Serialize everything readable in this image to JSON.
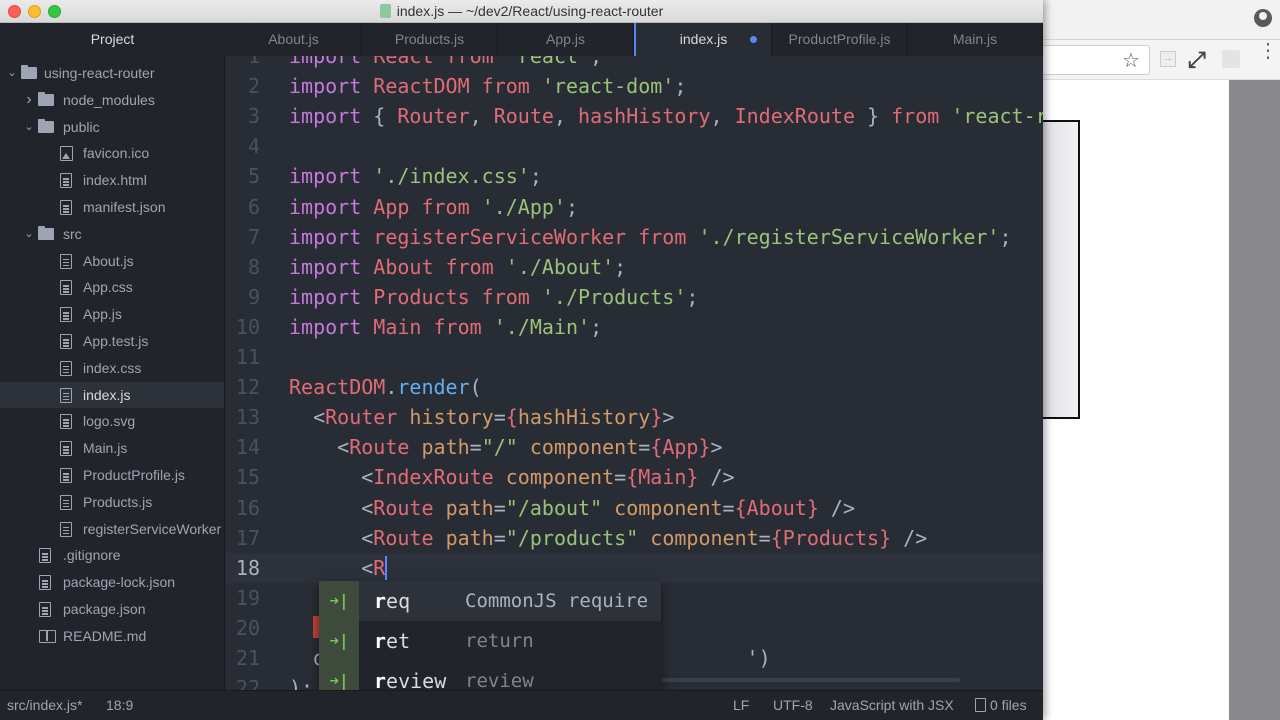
{
  "window": {
    "title": "index.js — ~/dev2/React/using-react-router"
  },
  "tabs": {
    "project_label": "Project",
    "items": [
      {
        "label": "About.js",
        "active": false
      },
      {
        "label": "Products.js",
        "active": false
      },
      {
        "label": "App.js",
        "active": false
      },
      {
        "label": "index.js",
        "active": true,
        "modified": true
      },
      {
        "label": "ProductProfile.js",
        "active": false
      },
      {
        "label": "Main.js",
        "active": false
      }
    ]
  },
  "tree": {
    "items": [
      {
        "label": "using-react-router",
        "type": "folder",
        "expanded": true,
        "depth": 0
      },
      {
        "label": "node_modules",
        "type": "folder",
        "expanded": false,
        "depth": 1
      },
      {
        "label": "public",
        "type": "folder",
        "expanded": true,
        "depth": 1
      },
      {
        "label": "favicon.ico",
        "type": "image",
        "depth": 2
      },
      {
        "label": "index.html",
        "type": "file",
        "depth": 2
      },
      {
        "label": "manifest.json",
        "type": "file",
        "depth": 2
      },
      {
        "label": "src",
        "type": "folder",
        "expanded": true,
        "depth": 1
      },
      {
        "label": "About.js",
        "type": "file",
        "depth": 2
      },
      {
        "label": "App.css",
        "type": "file",
        "depth": 2
      },
      {
        "label": "App.js",
        "type": "file",
        "depth": 2
      },
      {
        "label": "App.test.js",
        "type": "file",
        "depth": 2
      },
      {
        "label": "index.css",
        "type": "file",
        "depth": 2
      },
      {
        "label": "index.js",
        "type": "file",
        "depth": 2,
        "selected": true
      },
      {
        "label": "logo.svg",
        "type": "file",
        "depth": 2
      },
      {
        "label": "Main.js",
        "type": "file",
        "depth": 2
      },
      {
        "label": "ProductProfile.js",
        "type": "file",
        "depth": 2
      },
      {
        "label": "Products.js",
        "type": "file",
        "depth": 2
      },
      {
        "label": "registerServiceWorker",
        "type": "file",
        "depth": 2
      },
      {
        "label": ".gitignore",
        "type": "file",
        "depth": 1
      },
      {
        "label": "package-lock.json",
        "type": "file",
        "depth": 1
      },
      {
        "label": "package.json",
        "type": "file",
        "depth": 1
      },
      {
        "label": "README.md",
        "type": "book",
        "depth": 1
      }
    ]
  },
  "editor": {
    "lines": [
      {
        "n": "1",
        "tokens": [
          [
            "kw",
            "import"
          ],
          [
            "pun",
            " "
          ],
          [
            "id",
            "React"
          ],
          [
            "pun",
            " "
          ],
          [
            "id",
            "from"
          ],
          [
            "pun",
            " "
          ],
          [
            "str",
            "'react'"
          ],
          [
            "pun",
            ";"
          ]
        ]
      },
      {
        "n": "2",
        "tokens": [
          [
            "kw",
            "import"
          ],
          [
            "pun",
            " "
          ],
          [
            "id",
            "ReactDOM"
          ],
          [
            "pun",
            " "
          ],
          [
            "id",
            "from"
          ],
          [
            "pun",
            " "
          ],
          [
            "str",
            "'react-dom'"
          ],
          [
            "pun",
            ";"
          ]
        ]
      },
      {
        "n": "3",
        "tokens": [
          [
            "kw",
            "import"
          ],
          [
            "pun",
            " { "
          ],
          [
            "id",
            "Router"
          ],
          [
            "pun",
            ", "
          ],
          [
            "id",
            "Route"
          ],
          [
            "pun",
            ", "
          ],
          [
            "id",
            "hashHistory"
          ],
          [
            "pun",
            ", "
          ],
          [
            "id",
            "IndexRoute"
          ],
          [
            "pun",
            " } "
          ],
          [
            "id",
            "from"
          ],
          [
            "pun",
            " "
          ],
          [
            "str",
            "'react-router'"
          ],
          [
            "pun",
            ";"
          ]
        ]
      },
      {
        "n": "4",
        "tokens": []
      },
      {
        "n": "5",
        "tokens": [
          [
            "kw",
            "import"
          ],
          [
            "pun",
            " "
          ],
          [
            "str",
            "'./index.css'"
          ],
          [
            "pun",
            ";"
          ]
        ]
      },
      {
        "n": "6",
        "tokens": [
          [
            "kw",
            "import"
          ],
          [
            "pun",
            " "
          ],
          [
            "id",
            "App"
          ],
          [
            "pun",
            " "
          ],
          [
            "id",
            "from"
          ],
          [
            "pun",
            " "
          ],
          [
            "str",
            "'./App'"
          ],
          [
            "pun",
            ";"
          ]
        ]
      },
      {
        "n": "7",
        "tokens": [
          [
            "kw",
            "import"
          ],
          [
            "pun",
            " "
          ],
          [
            "id",
            "registerServiceWorker"
          ],
          [
            "pun",
            " "
          ],
          [
            "id",
            "from"
          ],
          [
            "pun",
            " "
          ],
          [
            "str",
            "'./registerServiceWorker'"
          ],
          [
            "pun",
            ";"
          ]
        ]
      },
      {
        "n": "8",
        "tokens": [
          [
            "kw",
            "import"
          ],
          [
            "pun",
            " "
          ],
          [
            "id",
            "About"
          ],
          [
            "pun",
            " "
          ],
          [
            "id",
            "from"
          ],
          [
            "pun",
            " "
          ],
          [
            "str",
            "'./About'"
          ],
          [
            "pun",
            ";"
          ]
        ]
      },
      {
        "n": "9",
        "tokens": [
          [
            "kw",
            "import"
          ],
          [
            "pun",
            " "
          ],
          [
            "id",
            "Products"
          ],
          [
            "pun",
            " "
          ],
          [
            "id",
            "from"
          ],
          [
            "pun",
            " "
          ],
          [
            "str",
            "'./Products'"
          ],
          [
            "pun",
            ";"
          ]
        ]
      },
      {
        "n": "10",
        "tokens": [
          [
            "kw",
            "import"
          ],
          [
            "pun",
            " "
          ],
          [
            "id",
            "Main"
          ],
          [
            "pun",
            " "
          ],
          [
            "id",
            "from"
          ],
          [
            "pun",
            " "
          ],
          [
            "str",
            "'./Main'"
          ],
          [
            "pun",
            ";"
          ]
        ]
      },
      {
        "n": "11",
        "tokens": []
      },
      {
        "n": "12",
        "tokens": [
          [
            "id",
            "ReactDOM"
          ],
          [
            "pun",
            "."
          ],
          [
            "fn",
            "render"
          ],
          [
            "pun",
            "("
          ]
        ]
      },
      {
        "n": "13",
        "tokens": [
          [
            "pun",
            "  <"
          ],
          [
            "id",
            "Router"
          ],
          [
            "pun",
            " "
          ],
          [
            "attr",
            "history"
          ],
          [
            "pun",
            "="
          ],
          [
            "id",
            "{"
          ],
          [
            "attr",
            "hashHistory"
          ],
          [
            "id",
            "}"
          ],
          [
            "pun",
            ">"
          ]
        ]
      },
      {
        "n": "14",
        "tokens": [
          [
            "pun",
            "    <"
          ],
          [
            "id",
            "Route"
          ],
          [
            "pun",
            " "
          ],
          [
            "attr",
            "path"
          ],
          [
            "pun",
            "="
          ],
          [
            "str",
            "\"/\""
          ],
          [
            "pun",
            " "
          ],
          [
            "attr",
            "component"
          ],
          [
            "pun",
            "="
          ],
          [
            "id",
            "{App}"
          ],
          [
            "pun",
            ">"
          ]
        ]
      },
      {
        "n": "15",
        "tokens": [
          [
            "pun",
            "      <"
          ],
          [
            "id",
            "IndexRoute"
          ],
          [
            "pun",
            " "
          ],
          [
            "attr",
            "component"
          ],
          [
            "pun",
            "="
          ],
          [
            "id",
            "{Main}"
          ],
          [
            "pun",
            " />"
          ]
        ]
      },
      {
        "n": "16",
        "tokens": [
          [
            "pun",
            "      <"
          ],
          [
            "id",
            "Route"
          ],
          [
            "pun",
            " "
          ],
          [
            "attr",
            "path"
          ],
          [
            "pun",
            "="
          ],
          [
            "str",
            "\"/about\""
          ],
          [
            "pun",
            " "
          ],
          [
            "attr",
            "component"
          ],
          [
            "pun",
            "="
          ],
          [
            "id",
            "{About}"
          ],
          [
            "pun",
            " />"
          ]
        ]
      },
      {
        "n": "17",
        "tokens": [
          [
            "pun",
            "      <"
          ],
          [
            "id",
            "Route"
          ],
          [
            "pun",
            " "
          ],
          [
            "attr",
            "path"
          ],
          [
            "pun",
            "="
          ],
          [
            "str",
            "\"/products\""
          ],
          [
            "pun",
            " "
          ],
          [
            "attr",
            "component"
          ],
          [
            "pun",
            "="
          ],
          [
            "id",
            "{Products}"
          ],
          [
            "pun",
            " />"
          ]
        ]
      },
      {
        "n": "18",
        "tokens": [
          [
            "pun",
            "      <"
          ],
          [
            "id",
            "R"
          ]
        ],
        "cursor": true
      },
      {
        "n": "19",
        "tokens": []
      },
      {
        "n": "20",
        "tokens": []
      },
      {
        "n": "21",
        "tokens": [
          [
            "pun",
            "  d                                   ')"
          ]
        ]
      },
      {
        "n": "22",
        "tokens": [
          [
            "pun",
            ");"
          ]
        ]
      }
    ]
  },
  "autocomplete": {
    "items": [
      {
        "prefix": "r",
        "rest": "eq",
        "desc": "CommonJS require",
        "selected": true
      },
      {
        "prefix": "r",
        "rest": "et",
        "desc": "return",
        "selected": false
      },
      {
        "prefix": "r",
        "rest": "eview",
        "desc": "review",
        "selected": false
      }
    ],
    "icon": "snippet-tab-icon"
  },
  "status": {
    "file_path": "src/index.js*",
    "cursor_pos": "18:9",
    "line_ending": "LF",
    "encoding": "UTF-8",
    "grammar": "JavaScript with JSX",
    "git_files": "0 files"
  },
  "browser": {
    "accent": "#568af2"
  }
}
